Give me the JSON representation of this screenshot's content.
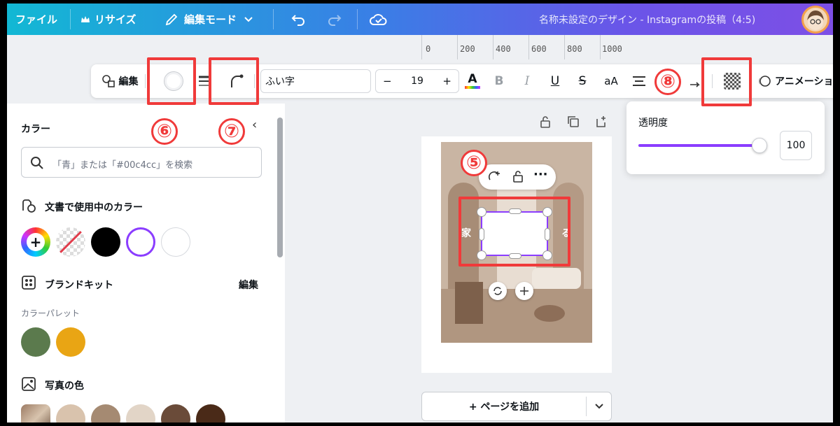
{
  "topbar": {
    "file": "ファイル",
    "resize": "リサイズ",
    "edit_mode": "編集モード",
    "doc_title": "名称未設定のデザイン - Instagramの投稿（4:5)"
  },
  "ruler": {
    "ticks": [
      "0",
      "200",
      "400",
      "600",
      "800",
      "1000"
    ]
  },
  "toolbar": {
    "edit": "編集",
    "font": "ふい字",
    "font_size": "19",
    "minus": "−",
    "plus": "+",
    "bold": "B",
    "italic": "I",
    "underline": "U",
    "strike": "S",
    "case": "aA",
    "animate": "アニメーショ"
  },
  "annotations": {
    "n5": "⑤",
    "n6": "⑥",
    "n7": "⑦",
    "n8": "⑧"
  },
  "panel": {
    "title": "カラー",
    "search_placeholder": "「青」または「#00c4cc」を検索",
    "doc_colors_title": "文書で使用中のカラー",
    "brand_kit_title": "ブランドキット",
    "brand_kit_edit": "編集",
    "palette_label": "カラーパレット",
    "photo_colors_title": "写真の色",
    "doc_colors": [
      "#000000",
      "#ffffff"
    ],
    "palette_colors": [
      "#5b7a4d",
      "#e9a514"
    ],
    "photo_colors": [
      "#d9c3ad",
      "#a58a72",
      "#e2d5c7",
      "#6a4b39",
      "#4a2a18"
    ]
  },
  "canvas": {
    "text_left": "家",
    "text_right": "る",
    "add_page": "+ ページを追加"
  },
  "opacity_popover": {
    "label": "透明度",
    "value": "100",
    "level": 1.0
  },
  "colors": {
    "accent": "#8b3dff",
    "highlight": "#f03a3a"
  }
}
